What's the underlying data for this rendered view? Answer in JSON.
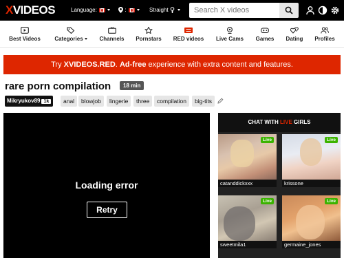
{
  "header": {
    "logo_x": "X",
    "logo_rest": "VIDEOS",
    "language_label": "Language:",
    "orientation_label": "Straight",
    "search_placeholder": "Search X videos"
  },
  "nav": [
    {
      "label": "Best Videos",
      "icon": "video-icon"
    },
    {
      "label": "Categories",
      "icon": "tags-icon"
    },
    {
      "label": "Channels",
      "icon": "tv-icon"
    },
    {
      "label": "Pornstars",
      "icon": "star-icon"
    },
    {
      "label": "RED videos",
      "icon": "red-icon"
    },
    {
      "label": "Live Cams",
      "icon": "webcam-icon"
    },
    {
      "label": "Games",
      "icon": "gamepad-icon"
    },
    {
      "label": "Dating",
      "icon": "hearts-icon"
    },
    {
      "label": "Profiles",
      "icon": "users-icon"
    }
  ],
  "banner": {
    "prefix": "Try ",
    "brand": "XVIDEOS.RED",
    "dot": ". ",
    "adfree": "Ad-free",
    "suffix": " experience with extra content and features."
  },
  "video": {
    "title": "rare porn compilation",
    "duration": "18 min",
    "channel": "Mikryukov89",
    "channel_count": "1k",
    "tags": [
      "anal",
      "blowjob",
      "lingerie",
      "three",
      "compilation",
      "big-tits"
    ]
  },
  "player": {
    "error_text": "Loading error",
    "retry_label": "Retry"
  },
  "chat": {
    "header_prefix": "CHAT WITH ",
    "header_live": "LIVE",
    "header_suffix": " GIRLS",
    "live_badge": "Live",
    "cams": [
      {
        "name": "catanddickxxx"
      },
      {
        "name": "krissone"
      },
      {
        "name": "sweetmila1"
      },
      {
        "name": "germaine_jones"
      }
    ]
  },
  "colors": {
    "brand_red": "#de2600",
    "live_green": "#3bb300"
  }
}
